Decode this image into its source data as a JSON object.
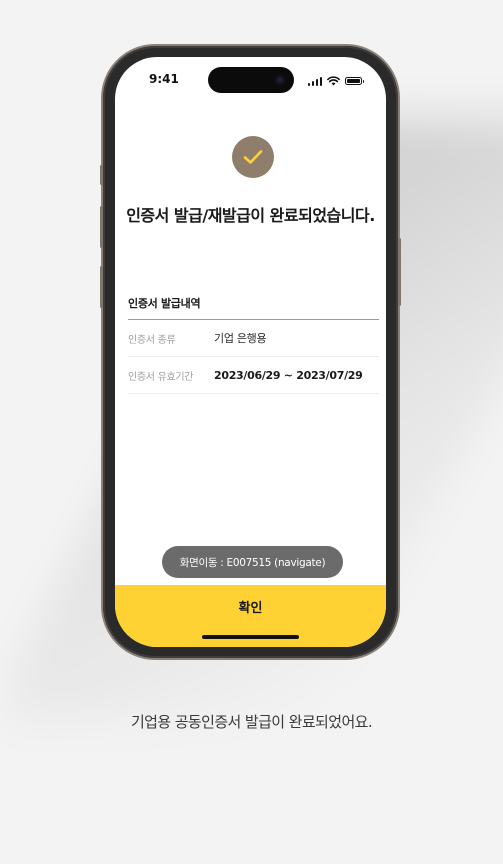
{
  "status_bar": {
    "time": "9:41"
  },
  "icons": {
    "check": "check-icon",
    "signal": "signal-icon",
    "wifi": "wifi-icon",
    "battery": "battery-icon"
  },
  "colors": {
    "accent": "#ffd234",
    "check_circle": "#8f7e6c",
    "check_mark": "#ffd234",
    "toast_bg": "#6b6b6b"
  },
  "result": {
    "title": "인증서 발급/재발급이 완료되었습니다."
  },
  "details": {
    "section_title": "인증서 발급내역",
    "rows": [
      {
        "label": "인증서 종류",
        "value": "기업 은행용"
      },
      {
        "label": "인증서 유효기간",
        "value": "2023/06/29 ~ 2023/07/29"
      }
    ]
  },
  "toast": {
    "text": "화면이동 : E007515 (navigate)"
  },
  "confirm_button": {
    "label": "확인"
  },
  "caption": "기업용 공동인증서 발급이 완료되었어요."
}
